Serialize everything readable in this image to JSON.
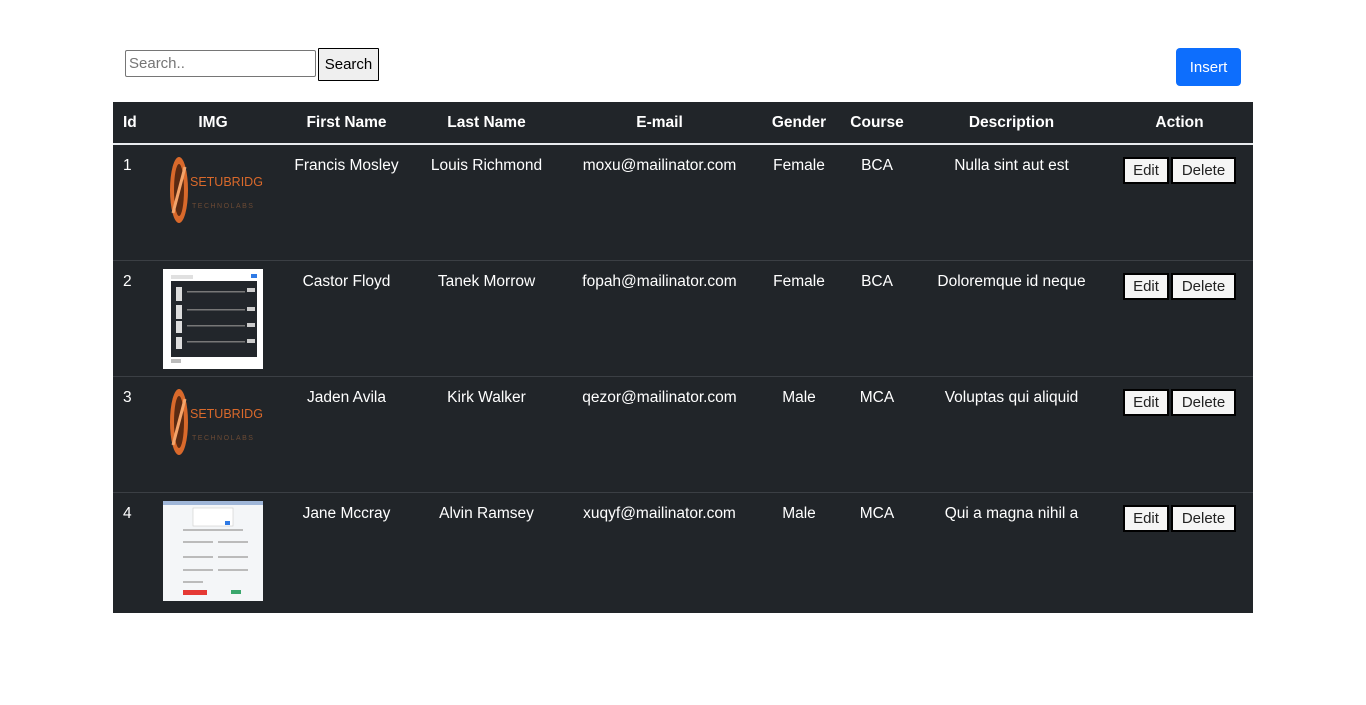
{
  "toolbar": {
    "search_placeholder": "Search..",
    "search_label": "Search",
    "insert_label": "Insert"
  },
  "table": {
    "headers": [
      "Id",
      "IMG",
      "First Name",
      "Last Name",
      "E-mail",
      "Gender",
      "Course",
      "Description",
      "Action"
    ],
    "rows": [
      {
        "id": "1",
        "img": "logo-image",
        "first": "Francis Mosley",
        "last": "Louis Richmond",
        "email": "moxu@mailinator.com",
        "gender": "Female",
        "course": "BCA",
        "desc": "Nulla sint aut est",
        "edit": "Edit",
        "delete": "Delete"
      },
      {
        "id": "2",
        "img": "screenshot-table-image",
        "first": "Castor Floyd",
        "last": "Tanek Morrow",
        "email": "fopah@mailinator.com",
        "gender": "Female",
        "course": "BCA",
        "desc": "Doloremque id neque",
        "edit": "Edit",
        "delete": "Delete"
      },
      {
        "id": "3",
        "img": "logo-image",
        "first": "Jaden Avila",
        "last": "Kirk Walker",
        "email": "qezor@mailinator.com",
        "gender": "Male",
        "course": "MCA",
        "desc": "Voluptas qui aliquid",
        "edit": "Edit",
        "delete": "Delete"
      },
      {
        "id": "4",
        "img": "screenshot-form-image",
        "first": "Jane Mccray",
        "last": "Alvin Ramsey",
        "email": "xuqyf@mailinator.com",
        "gender": "Male",
        "course": "MCA",
        "desc": "Qui a magna nihil a",
        "edit": "Edit",
        "delete": "Delete"
      }
    ]
  },
  "logo": {
    "line1": "SETUBRIDGE",
    "line2": "TECHNOLABS"
  },
  "colors": {
    "table_bg": "#212529",
    "insert_bg": "#0d6efd",
    "logo_orange": "#d9692b"
  }
}
